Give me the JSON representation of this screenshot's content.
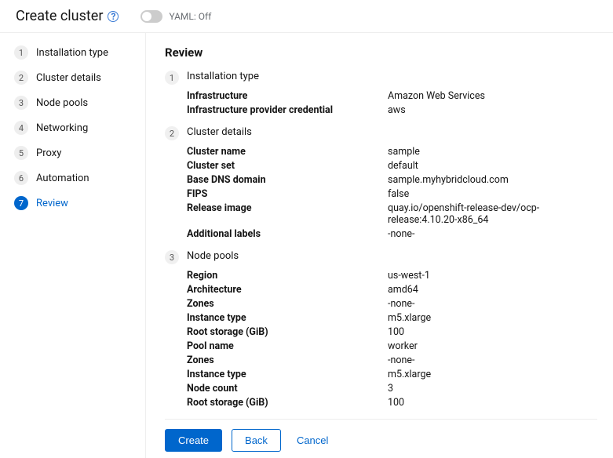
{
  "header": {
    "title": "Create cluster",
    "yaml_label": "YAML: Off"
  },
  "sidebar": {
    "steps": [
      {
        "num": "1",
        "label": "Installation type"
      },
      {
        "num": "2",
        "label": "Cluster details"
      },
      {
        "num": "3",
        "label": "Node pools"
      },
      {
        "num": "4",
        "label": "Networking"
      },
      {
        "num": "5",
        "label": "Proxy"
      },
      {
        "num": "6",
        "label": "Automation"
      },
      {
        "num": "7",
        "label": "Review"
      }
    ],
    "active_index": 6
  },
  "review": {
    "title": "Review",
    "sections": [
      {
        "num": "1",
        "title": "Installation type",
        "rows": [
          {
            "key": "Infrastructure",
            "val": "Amazon Web Services"
          },
          {
            "key": "Infrastructure provider credential",
            "val": "aws"
          }
        ]
      },
      {
        "num": "2",
        "title": "Cluster details",
        "rows": [
          {
            "key": "Cluster name",
            "val": "sample"
          },
          {
            "key": "Cluster set",
            "val": "default"
          },
          {
            "key": "Base DNS domain",
            "val": "sample.myhybridcloud.com"
          },
          {
            "key": "FIPS",
            "val": "false"
          },
          {
            "key": "Release image",
            "val": "quay.io/openshift-release-dev/ocp-release:4.10.20-x86_64"
          },
          {
            "key": "Additional labels",
            "val": "-none-"
          }
        ]
      },
      {
        "num": "3",
        "title": "Node pools",
        "rows": [
          {
            "key": "Region",
            "val": "us-west-1"
          },
          {
            "key": "Architecture",
            "val": "amd64"
          },
          {
            "key": "Zones",
            "val": "-none-"
          },
          {
            "key": "Instance type",
            "val": "m5.xlarge"
          },
          {
            "key": "Root storage (GiB)",
            "val": "100"
          },
          {
            "key": "Pool name",
            "val": "worker"
          },
          {
            "key": "Zones",
            "val": "-none-"
          },
          {
            "key": "Instance type",
            "val": "m5.xlarge"
          },
          {
            "key": "Node count",
            "val": "3"
          },
          {
            "key": "Root storage (GiB)",
            "val": "100"
          }
        ]
      }
    ]
  },
  "footer": {
    "create": "Create",
    "back": "Back",
    "cancel": "Cancel"
  }
}
